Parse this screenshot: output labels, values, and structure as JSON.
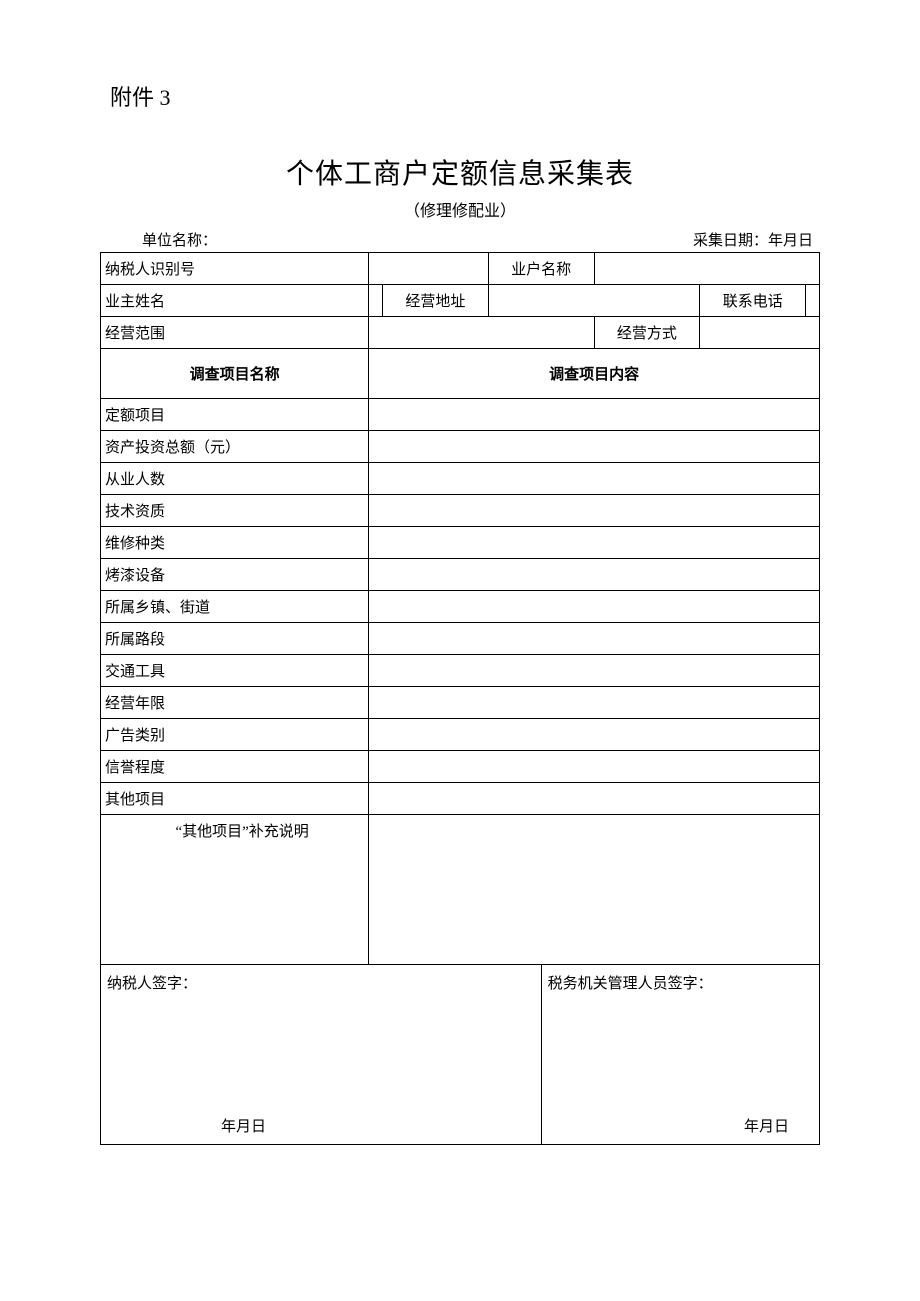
{
  "attachment": "附件 3",
  "title": "个体工商户定额信息采集表",
  "subtitle": "（修理修配业）",
  "header": {
    "unit_name_label": "单位名称：",
    "collect_date_label": "采集日期：年月日"
  },
  "fields": {
    "taxpayer_id": "纳税人识别号",
    "business_name": "业户名称",
    "owner_name": "业主姓名",
    "business_address": "经营地址",
    "phone": "联系电话",
    "business_scope": "经营范围",
    "business_mode": "经营方式"
  },
  "survey": {
    "name_header": "调查项目名称",
    "content_header": "调查项目内容",
    "items": {
      "quota_project": "定额项目",
      "investment_total": "资产投资总额（元）",
      "employee_count": "从业人数",
      "tech_qualification": "技术资质",
      "repair_type": "维修种类",
      "paint_equipment": "烤漆设备",
      "township_street": "所属乡镇、街道",
      "road_section": "所属路段",
      "transportation": "交通工具",
      "business_years": "经营年限",
      "ad_category": "广告类别",
      "reputation": "信誉程度",
      "other_items": "其他项目"
    },
    "supplement_label": "“其他项目”补充说明"
  },
  "signature": {
    "taxpayer_sign": "纳税人签字：",
    "tax_officer_sign": "税务机关管理人员签字：",
    "date_text": "年月日"
  }
}
